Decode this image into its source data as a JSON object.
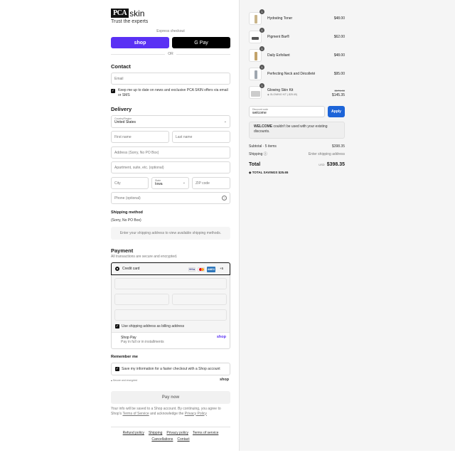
{
  "brand": {
    "logo_mark": "PCA",
    "logo_word": "skin",
    "tagline": "Trust the experts"
  },
  "express": {
    "label": "Express checkout",
    "shop_pay": "shop",
    "gpay": "G Pay",
    "or": "OR"
  },
  "contact": {
    "title": "Contact",
    "email_placeholder": "Email",
    "newsletter": "Keep me up to date on news and exclusive PCA SKIN offers via email or SMS"
  },
  "delivery": {
    "title": "Delivery",
    "country_label": "Country/Region",
    "country_value": "United States",
    "first_name": "First name",
    "last_name": "Last name",
    "address": "Address (Sorry, No PO Box)",
    "apartment": "Apartment, suite, etc. (optional)",
    "city": "City",
    "state_label": "State",
    "state_value": "Iowa",
    "zip": "ZIP code",
    "phone": "Phone (optional)"
  },
  "shipping_method": {
    "title": "Shipping method",
    "note": "(Sorry, No PO Box)",
    "placeholder": "Enter your shipping address to view available shipping methods."
  },
  "payment": {
    "title": "Payment",
    "subtitle": "All transactions are secure and encrypted.",
    "credit_card": "Credit card",
    "cards": [
      "VISA",
      "MC",
      "AMEX"
    ],
    "more_cards": "+5",
    "billing_same": "Use shipping address as billing address",
    "shop_pay_title": "Shop Pay",
    "shop_pay_sub": "Pay in full or in installments",
    "shop_pay_logo": "shop"
  },
  "remember": {
    "title": "Remember me",
    "save_info": "Save my information for a faster checkout with a Shop account",
    "secure": "Secure and encrypted",
    "shop_logo": "shop"
  },
  "pay_now": "Pay now",
  "legal": {
    "line1": "Your info will be saved to a Shop account. By continuing, you agree to",
    "shop_prefix": "Shop's",
    "terms": "Terms of Service",
    "and_ack": "and acknowledge the",
    "privacy": "Privacy Policy"
  },
  "footer_links": [
    "Refund policy",
    "Shipping",
    "Privacy policy",
    "Terms of service",
    "Cancellations",
    "Contact"
  ],
  "cart": {
    "items": [
      {
        "name": "Hydrating Toner",
        "price": "$48.00",
        "qty": "1"
      },
      {
        "name": "Pigment Bar®",
        "price": "$62.00",
        "qty": "1"
      },
      {
        "name": "Daily Exfoliant",
        "price": "$48.00",
        "qty": "1"
      },
      {
        "name": "Perfecting Neck and Décolleté",
        "price": "$95.00",
        "qty": "1"
      },
      {
        "name": "Glowing Skin Kit",
        "tag": "GLOWING KIT (-$25.65)",
        "old_price": "$171.00",
        "price": "$145.35",
        "qty": "1"
      }
    ],
    "discount_label": "Discount code",
    "discount_value": "welcome",
    "apply": "Apply",
    "notice_code": "WELCOME",
    "notice_text": "couldn't be used with your existing discounts.",
    "subtotal_label": "Subtotal · 5 items",
    "subtotal": "$398.35",
    "shipping_label": "Shipping",
    "shipping_value": "Enter shipping address",
    "total_label": "Total",
    "currency": "USD",
    "total": "$398.35",
    "savings_label": "TOTAL SAVINGS",
    "savings": "$25.65"
  },
  "colors": {
    "shop_purple": "#5a31f4",
    "apply_blue": "#1d64d8",
    "amex_blue": "#2e77bb"
  }
}
